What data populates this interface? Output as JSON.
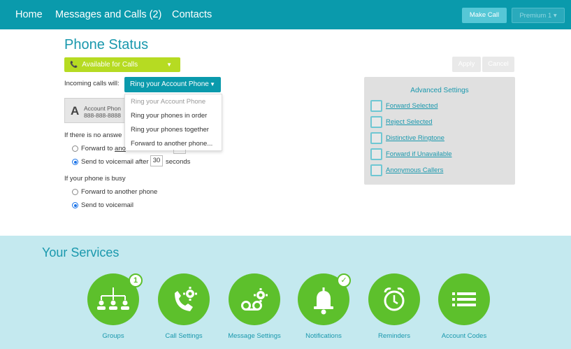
{
  "nav": {
    "home": "Home",
    "messages": "Messages and Calls (2)",
    "contacts": "Contacts",
    "make_call": "Make Call",
    "premium": "Premium 1 ▾"
  },
  "phone_status": {
    "title": "Phone Status",
    "availability": "Available for Calls",
    "incoming_label": "Incoming calls will:",
    "ring_selected": "Ring your Account Phone",
    "dropdown_options": [
      "Ring your Account Phone",
      "Ring your phones in order",
      "Ring your phones together",
      "Forward to another phone..."
    ],
    "account": {
      "letter": "A",
      "name": "Account Phon",
      "number": "888-888-8888"
    },
    "no_answer_label": "If there is no answe",
    "no_answer_forward": "Forward to ano",
    "no_answer_forward_link": "ano",
    "voicemail_after_prefix": "Send to voicemail after",
    "voicemail_seconds": "30",
    "voicemail_after_suffix": "seconds",
    "busy_label": "If your phone is busy",
    "busy_forward": "Forward to another phone",
    "busy_voicemail": "Send to voicemail",
    "apply": "Apply",
    "cancel": "Cancel"
  },
  "advanced": {
    "title": "Advanced Settings",
    "items": [
      "Forward Selected",
      "Reject Selected",
      "Distinctive Ringtone",
      "Forward if Unavailable",
      "Anonymous Callers"
    ]
  },
  "services": {
    "title": "Your Services",
    "items": [
      {
        "label": "Groups",
        "icon": "groups-icon",
        "badge": "1"
      },
      {
        "label": "Call Settings",
        "icon": "call-settings-icon"
      },
      {
        "label": "Message Settings",
        "icon": "voicemail-settings-icon"
      },
      {
        "label": "Notifications",
        "icon": "bell-icon",
        "badge": "✓"
      },
      {
        "label": "Reminders",
        "icon": "alarm-clock-icon"
      },
      {
        "label": "Account Codes",
        "icon": "list-icon"
      }
    ]
  },
  "colors": {
    "teal": "#0a9aac",
    "green": "#5dc02c",
    "lime": "#b6db22",
    "services_bg": "#c4e9ef"
  }
}
